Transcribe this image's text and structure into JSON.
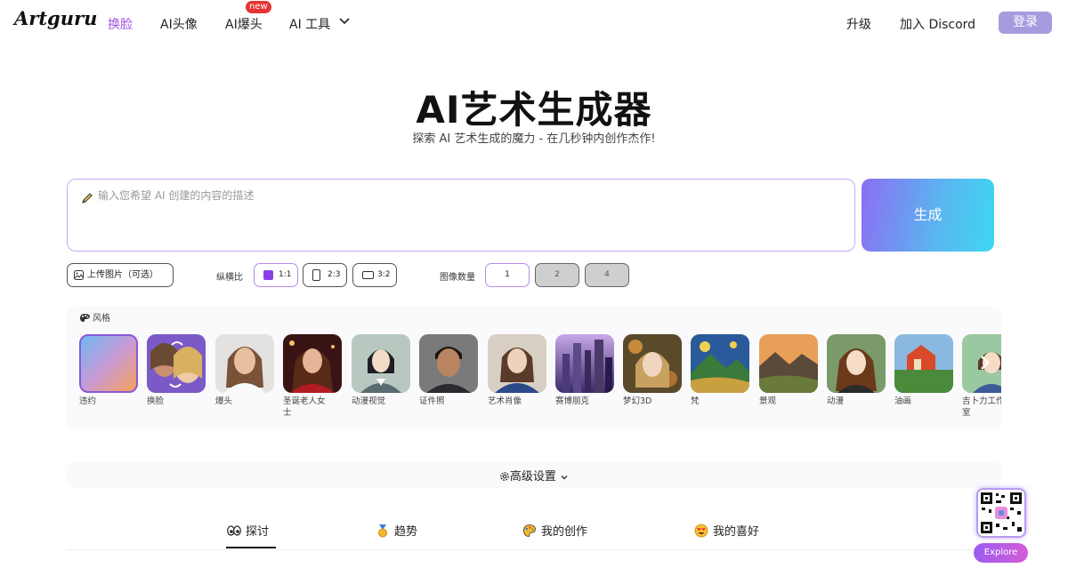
{
  "nav": {
    "logo": "Artguru",
    "items": [
      {
        "label": "换脸",
        "active": true
      },
      {
        "label": "AI头像",
        "active": false
      },
      {
        "label": "AI爆头",
        "active": false
      },
      {
        "label": "AI 工具",
        "active": false
      }
    ],
    "new_badge": "new",
    "upgrade": "升级",
    "discord": "加入 Discord",
    "login": "登录"
  },
  "hero": {
    "title": "AI艺术生成器",
    "subtitle": "探索 AI 艺术生成的魔力 - 在几秒钟内创作杰作!"
  },
  "prompt": {
    "placeholder": "输入您希望 AI 创建的内容的描述",
    "value": "",
    "generate_label": "生成"
  },
  "controls": {
    "upload_label": "上传图片（可选）",
    "aspect_label": "纵横比",
    "aspects": [
      {
        "label": "1:1",
        "active": true
      },
      {
        "label": "2:3",
        "active": false
      },
      {
        "label": "3:2",
        "active": false
      }
    ],
    "count_label": "图像数量",
    "counts": [
      {
        "label": "1",
        "active": true
      },
      {
        "label": "2",
        "active": false
      },
      {
        "label": "4",
        "active": false
      }
    ]
  },
  "styles": {
    "heading": "风格",
    "items": [
      {
        "label": "违约",
        "active": true
      },
      {
        "label": "换脸"
      },
      {
        "label": "爆头"
      },
      {
        "label": "圣诞老人女士"
      },
      {
        "label": "动漫视觉"
      },
      {
        "label": "证件照"
      },
      {
        "label": "艺术肖像"
      },
      {
        "label": "赛博朋克"
      },
      {
        "label": "梦幻3D"
      },
      {
        "label": "梵"
      },
      {
        "label": "景观"
      },
      {
        "label": "动漫"
      },
      {
        "label": "油画"
      },
      {
        "label": "吉卜力工作室"
      }
    ]
  },
  "advanced": {
    "label": "高级设置"
  },
  "tabs": [
    {
      "label": "探讨",
      "active": true
    },
    {
      "label": "趋势"
    },
    {
      "label": "我的创作"
    },
    {
      "label": "我的喜好"
    }
  ],
  "float": {
    "explore_label": "Explore"
  },
  "colors": {
    "accent": "#a052e8",
    "login_bg": "#a79be0"
  }
}
